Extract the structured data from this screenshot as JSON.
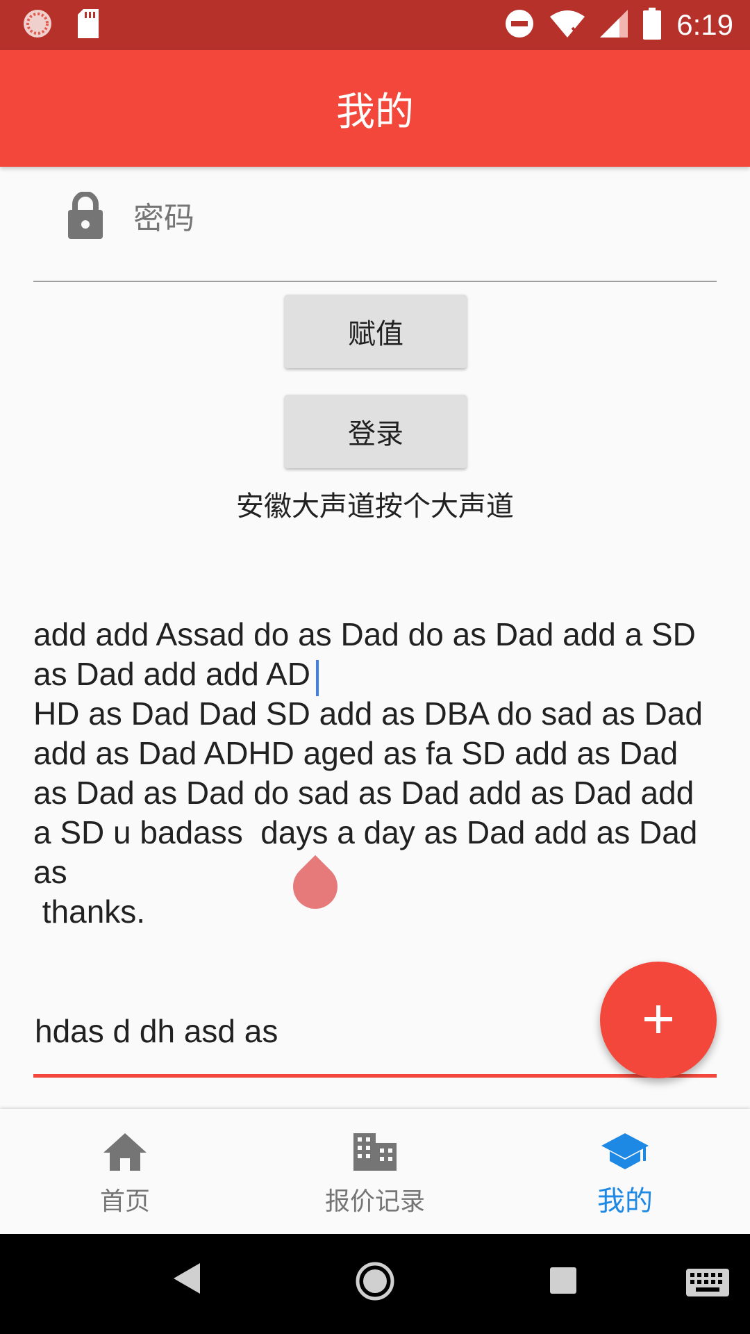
{
  "status_bar": {
    "time": "6:19",
    "icons": [
      "app-status-icon",
      "sd-card-icon",
      "do-not-disturb-icon",
      "wifi-icon",
      "signal-icon",
      "battery-icon"
    ]
  },
  "app_bar": {
    "title": "我的"
  },
  "form": {
    "password_placeholder": "密码",
    "assign_button": "赋值",
    "login_button": "登录",
    "info_text": "安徽大声道按个大声道",
    "long_text": "add add Assad do as Dad do as Dad add a SD\nas Dad add add AD\nHD as Dad Dad SD add as DBA do sad as Dad\nadd as Dad ADHD aged as fa SD add as Dad\nas Dad as Dad do sad as Dad add as Dad add\na SD u badass  days a day as Dad add as Dad\nas\n thanks.",
    "second_input_value": "hdas d dh asd as"
  },
  "fab": {
    "icon": "plus-icon"
  },
  "bottom_nav": {
    "items": [
      {
        "label": "首页",
        "icon": "home-icon",
        "active": false
      },
      {
        "label": "报价记录",
        "icon": "building-icon",
        "active": false
      },
      {
        "label": "我的",
        "icon": "school-icon",
        "active": true
      }
    ]
  },
  "colors": {
    "status_bar": "#b7312b",
    "primary": "#f4473b",
    "active_nav": "#1e88e5",
    "cursor": "#3f7fe6"
  },
  "system_nav": {
    "icons": [
      "back-icon",
      "home-button-icon",
      "recents-icon",
      "keyboard-icon"
    ]
  }
}
